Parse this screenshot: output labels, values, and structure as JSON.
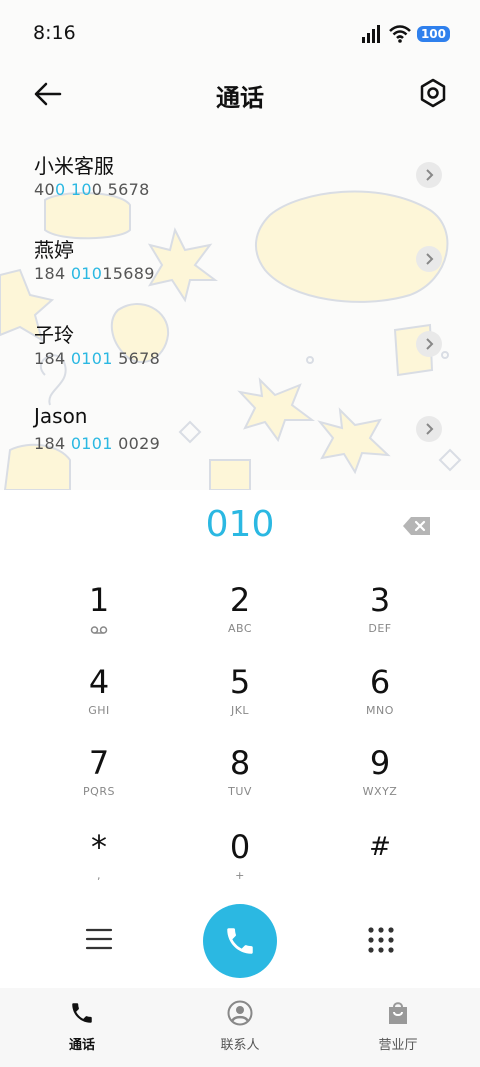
{
  "status_bar": {
    "time": "8:16",
    "battery": "100"
  },
  "header": {
    "title": "通话"
  },
  "contacts": [
    {
      "name": "小米客服",
      "number_parts": [
        "40",
        "0 10",
        "0 5678"
      ]
    },
    {
      "name": "燕婷",
      "number_parts": [
        "184 ",
        "010",
        "15689"
      ]
    },
    {
      "name": "子玲",
      "number_parts": [
        "184 ",
        "0101",
        " 5678"
      ]
    },
    {
      "name": "Jason",
      "number_parts": [
        "184 ",
        "0101",
        " 0029"
      ]
    }
  ],
  "dialer": {
    "input": "010"
  },
  "keys": [
    {
      "digit": "1",
      "letters": ""
    },
    {
      "digit": "2",
      "letters": "ABC"
    },
    {
      "digit": "3",
      "letters": "DEF"
    },
    {
      "digit": "4",
      "letters": "GHI"
    },
    {
      "digit": "5",
      "letters": "JKL"
    },
    {
      "digit": "6",
      "letters": "MNO"
    },
    {
      "digit": "7",
      "letters": "PQRS"
    },
    {
      "digit": "8",
      "letters": "TUV"
    },
    {
      "digit": "9",
      "letters": "WXYZ"
    },
    {
      "digit": "*",
      "letters": ","
    },
    {
      "digit": "0",
      "letters": "+"
    },
    {
      "digit": "#",
      "letters": ""
    }
  ],
  "bottom_nav": [
    {
      "label": "通话",
      "icon": "phone-icon",
      "active": true
    },
    {
      "label": "联系人",
      "icon": "person-icon",
      "active": false
    },
    {
      "label": "营业厅",
      "icon": "shopping-bag-icon",
      "active": false
    }
  ],
  "colors": {
    "accent": "#2bb8e2",
    "battery": "#2f80ed"
  }
}
